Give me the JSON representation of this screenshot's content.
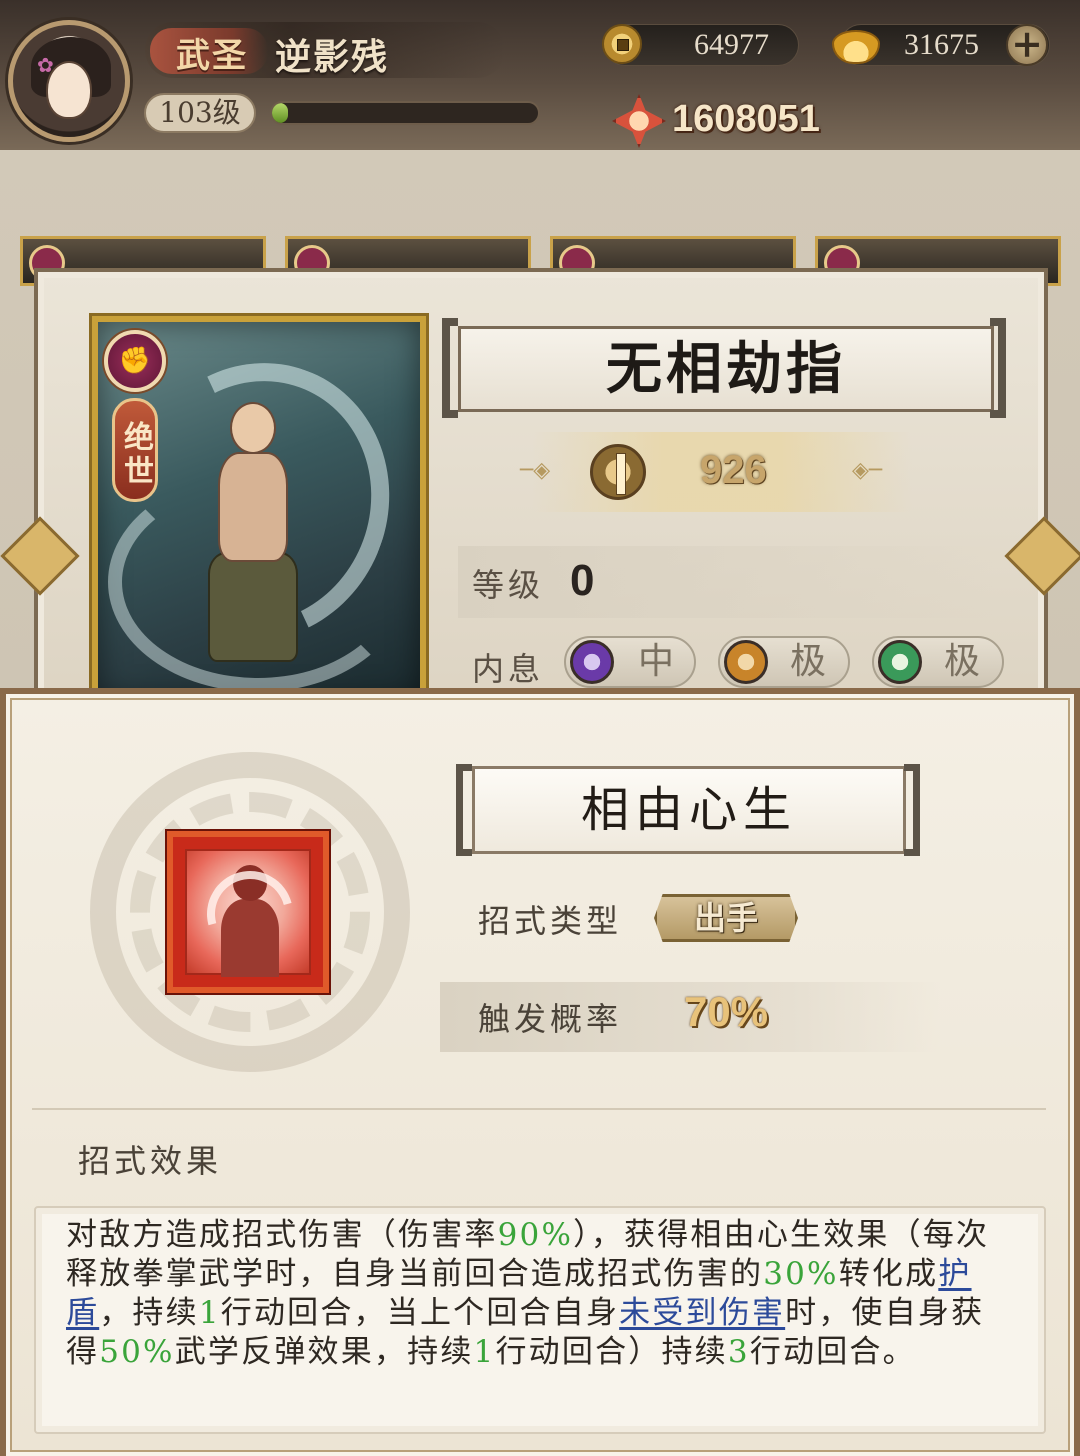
{
  "player": {
    "rank": "武圣",
    "name": "逆影残",
    "level": "103级",
    "exp_fraction": 0.06,
    "power": "1608051"
  },
  "resources": {
    "coins": "64977",
    "gold": "31675",
    "add_symbol": "+"
  },
  "card": {
    "grade": "绝世",
    "name": "无相劫指",
    "power": "926",
    "level_label": "等级",
    "level_value": "0",
    "inner_label": "内息",
    "inner": [
      {
        "icon": "moon-orb-icon",
        "value": "中",
        "color": "#6a3aa8"
      },
      {
        "icon": "sun-orb-icon",
        "value": "极",
        "color": "#c8842a"
      },
      {
        "icon": "jade-orb-icon",
        "value": "极",
        "color": "#3a9a5a"
      }
    ]
  },
  "move": {
    "name": "相由心生",
    "type_label": "招式类型",
    "type_value": "出手",
    "trigger_label": "触发概率",
    "trigger_value": "70%",
    "effect_title": "招式效果",
    "description": [
      {
        "t": "对敌方造成招式伤害（伤害率"
      },
      {
        "t": "90%",
        "s": "hl"
      },
      {
        "t": "），获得相由心生效果（每次释放拳掌武学时，自身当前回合造成招式伤害的"
      },
      {
        "t": "30%",
        "s": "hl"
      },
      {
        "t": "转化成"
      },
      {
        "t": "护盾",
        "s": "kw"
      },
      {
        "t": "，持续"
      },
      {
        "t": "1",
        "s": "hl"
      },
      {
        "t": "行动回合，当上个回合自身"
      },
      {
        "t": "未受到伤害",
        "s": "kw"
      },
      {
        "t": "时，使自身获得"
      },
      {
        "t": "50%",
        "s": "hl"
      },
      {
        "t": "武学反弹效果，持续"
      },
      {
        "t": "1",
        "s": "hl"
      },
      {
        "t": "行动回合）持续"
      },
      {
        "t": "3",
        "s": "hl"
      },
      {
        "t": "行动回合。"
      }
    ]
  }
}
